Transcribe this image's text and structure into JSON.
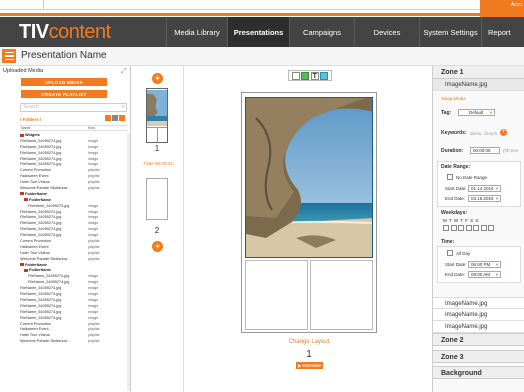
{
  "top_account": "Acco",
  "logo": {
    "part1": "TIV",
    "part2": "content"
  },
  "nav": [
    {
      "label": "Media Library",
      "active": false
    },
    {
      "label": "Presentations",
      "active": true
    },
    {
      "label": "Campaigns",
      "active": false
    },
    {
      "label": "Devices",
      "active": false
    },
    {
      "label": "System Settings",
      "active": false
    },
    {
      "label": "Report",
      "active": false
    }
  ],
  "presentation_name": "Presentation Name",
  "media": {
    "header": "Uploaded Media",
    "upload_label": "UPLOAD MEDIA",
    "playlist_label": "CREATE PLAYLIST",
    "search_placeholder": "Search",
    "crumb": "/ Folders /",
    "col_name": "Name",
    "col_kind": "Kind",
    "rows": [
      {
        "name": "Widgets",
        "kind": "",
        "type": "folder",
        "indent": 0
      },
      {
        "name": "FileName_54059274.jpg",
        "kind": "image",
        "type": "file",
        "indent": 0
      },
      {
        "name": "FileName_54059274.jpg",
        "kind": "image",
        "type": "file",
        "indent": 0
      },
      {
        "name": "FileName_54059274.jpg",
        "kind": "image",
        "type": "file",
        "indent": 0
      },
      {
        "name": "FileName_54059274.jpg",
        "kind": "image",
        "type": "file",
        "indent": 0
      },
      {
        "name": "FileName_54059274.jpg",
        "kind": "image",
        "type": "file",
        "indent": 0
      },
      {
        "name": "Current Promotion",
        "kind": "playlist",
        "type": "file",
        "indent": 0
      },
      {
        "name": "Halloween Event",
        "kind": "playlist",
        "type": "file",
        "indent": 0
      },
      {
        "name": "Hotel Tour Videos",
        "kind": "playlist",
        "type": "file",
        "indent": 0
      },
      {
        "name": "Welcome Parade Slideshow",
        "kind": "playlist",
        "type": "file",
        "indent": 0
      },
      {
        "name": "FolderName",
        "kind": "",
        "type": "folder",
        "indent": 0
      },
      {
        "name": "FolderName",
        "kind": "",
        "type": "folder",
        "indent": 1
      },
      {
        "name": "FileName_54059274.jpg",
        "kind": "image",
        "type": "file",
        "indent": 2
      },
      {
        "name": "FileName_54059274.jpg",
        "kind": "image",
        "type": "file",
        "indent": 0
      },
      {
        "name": "FileName_54059274.jpg",
        "kind": "image",
        "type": "file",
        "indent": 0
      },
      {
        "name": "FileName_54059274.jpg",
        "kind": "image",
        "type": "file",
        "indent": 0
      },
      {
        "name": "FileName_54059274.jpg",
        "kind": "image",
        "type": "file",
        "indent": 0
      },
      {
        "name": "FileName_54059274.jpg",
        "kind": "image",
        "type": "file",
        "indent": 0
      },
      {
        "name": "Current Promotion",
        "kind": "playlist",
        "type": "file",
        "indent": 0
      },
      {
        "name": "Halloween Event",
        "kind": "playlist",
        "type": "file",
        "indent": 0
      },
      {
        "name": "Hotel Tour Videos",
        "kind": "playlist",
        "type": "file",
        "indent": 0
      },
      {
        "name": "Welcome Parade Slideshow",
        "kind": "playlist",
        "type": "file",
        "indent": 0
      },
      {
        "name": "FolderName",
        "kind": "",
        "type": "folder",
        "indent": 0
      },
      {
        "name": "FolderName",
        "kind": "",
        "type": "folder",
        "indent": 1
      },
      {
        "name": "FileName_54059274.jpg",
        "kind": "image",
        "type": "file",
        "indent": 2
      },
      {
        "name": "FileName_54059274.jpg",
        "kind": "image",
        "type": "file",
        "indent": 2
      },
      {
        "name": "FileName_54059274.jpg",
        "kind": "image",
        "type": "file",
        "indent": 0
      },
      {
        "name": "FileName_54059274.jpg",
        "kind": "image",
        "type": "file",
        "indent": 0
      },
      {
        "name": "FileName_54059274.jpg",
        "kind": "image",
        "type": "file",
        "indent": 0
      },
      {
        "name": "FileName_54059274.jpg",
        "kind": "image",
        "type": "file",
        "indent": 0
      },
      {
        "name": "FileName_54059274.jpg",
        "kind": "image",
        "type": "file",
        "indent": 0
      },
      {
        "name": "FileName_54059274.jpg",
        "kind": "image",
        "type": "file",
        "indent": 0
      },
      {
        "name": "Current Promotion",
        "kind": "playlist",
        "type": "file",
        "indent": 0
      },
      {
        "name": "Halloween Event",
        "kind": "playlist",
        "type": "file",
        "indent": 0
      },
      {
        "name": "Hotel Tour Videos",
        "kind": "playlist",
        "type": "file",
        "indent": 0
      },
      {
        "name": "Welcome Parade Slideshow",
        "kind": "playlist",
        "type": "file",
        "indent": 0
      }
    ]
  },
  "slides": {
    "slide1_num": "1",
    "fade_label": "Fade 00:00:03",
    "slide2_num": "2"
  },
  "canvas": {
    "change_layout": "Change Layout",
    "page_num": "1",
    "preview_label": "▶ PREVIEW"
  },
  "props": {
    "zone1_title": "Zone 1",
    "selected_file": "ImageName.jpg",
    "swap_label": "Swap Media",
    "tag_label": "Tag:",
    "tag_value": "Default",
    "keywords_label": "Keywords:",
    "keywords_placeholder": "dress, church",
    "duration_label": "Duration:",
    "duration_value": "00:00:05",
    "duration_hint": "(hh:mm",
    "date_range_label": "Date Range:",
    "no_date_label": "No Date Range",
    "start_date_label": "Start Date:",
    "start_date_value": "01.14.2016",
    "end_date_label": "End Date:",
    "end_date_value": "03.15.2016",
    "weekdays_label": "Weekdays:",
    "weekday_letters": "M  T  W  T  F  S  S",
    "time_label": "Time:",
    "all_day_label": "All Day",
    "start_time_label": "Start Date:",
    "start_time_value": "06:00 PM",
    "end_time_label": "End Date:",
    "end_time_value": "09:00 AM",
    "files": [
      "ImageName.jpg",
      "ImageName.jpg",
      "ImageName.jpg"
    ],
    "zone2_title": "Zone 2",
    "zone3_title": "Zone 3",
    "background_title": "Background"
  },
  "colors": {
    "accent": "#f07b21",
    "nav_bg": "#444444",
    "nav_active": "#2e2e2e"
  }
}
